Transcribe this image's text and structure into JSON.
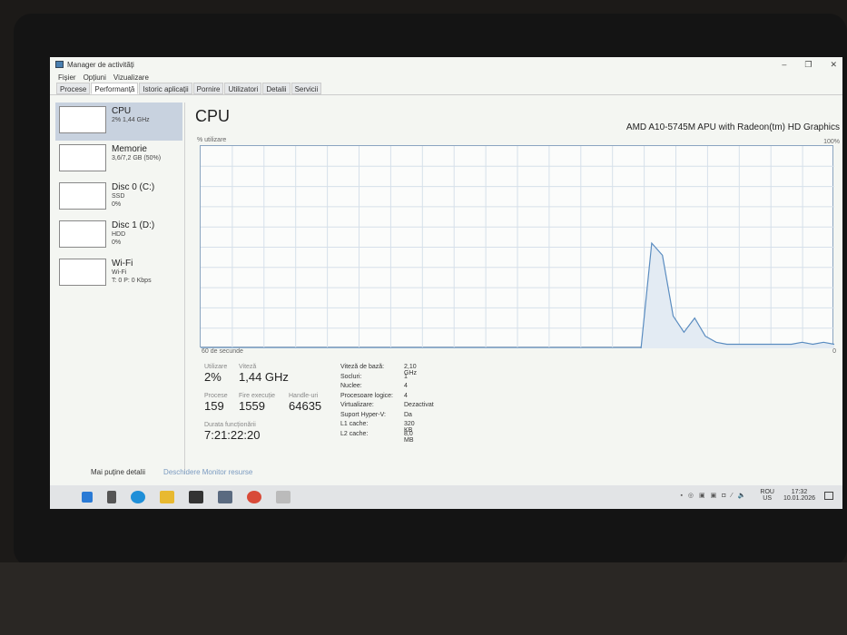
{
  "window": {
    "title": "Manager de activități",
    "controls": [
      "–",
      "❐",
      "✕"
    ]
  },
  "menu": [
    "Fișier",
    "Opțiuni",
    "Vizualizare"
  ],
  "tabs": [
    "Procese",
    "Performanță",
    "Istoric aplicații",
    "Pornire",
    "Utilizatori",
    "Detalii",
    "Servicii"
  ],
  "sidebar": [
    {
      "name": "CPU",
      "sub1": "2% 1,44 GHz",
      "sub2": ""
    },
    {
      "name": "Memorie",
      "sub1": "3,6/7,2 GB (50%)",
      "sub2": ""
    },
    {
      "name": "Disc 0 (C:)",
      "sub1": "SSD",
      "sub2": "0%"
    },
    {
      "name": "Disc 1 (D:)",
      "sub1": "HDD",
      "sub2": "0%"
    },
    {
      "name": "Wi-Fi",
      "sub1": "Wi-Fi",
      "sub2": "T: 0 P: 0 Kbps"
    }
  ],
  "main": {
    "title": "CPU",
    "model": "AMD A10-5745M APU with Radeon(tm) HD Graphics",
    "y_label": "% utilizare",
    "y_max": "100%",
    "y_min": "0",
    "x_label": "60 de secunde"
  },
  "chart_data": {
    "type": "area",
    "ylim": [
      0,
      100
    ],
    "xlabel": "60 de secunde",
    "ylabel": "% utilizare",
    "values": [
      0,
      0,
      0,
      0,
      0,
      0,
      0,
      0,
      0,
      0,
      0,
      0,
      0,
      0,
      0,
      0,
      0,
      0,
      0,
      0,
      0,
      0,
      0,
      0,
      0,
      0,
      0,
      0,
      0,
      0,
      0,
      0,
      0,
      0,
      0,
      0,
      0,
      0,
      0,
      0,
      0,
      0,
      52,
      46,
      16,
      8,
      15,
      6,
      3,
      2,
      2,
      2,
      2,
      2,
      2,
      2,
      3,
      2,
      3,
      2
    ]
  },
  "stats": {
    "util_label": "Utilizare",
    "util": "2%",
    "speed_label": "Viteză",
    "speed": "1,44 GHz",
    "proc_label": "Procese",
    "proc": "159",
    "threads_label": "Fire execuție",
    "threads": "1559",
    "handles_label": "Handle-uri",
    "handles": "64635",
    "uptime_label": "Durata funcționării",
    "uptime": "7:21:22:20"
  },
  "specs": [
    [
      "Viteză de bază:",
      "2,10 GHz"
    ],
    [
      "Socluri:",
      "1"
    ],
    [
      "Nuclee:",
      "4"
    ],
    [
      "Procesoare logice:",
      "4"
    ],
    [
      "Virtualizare:",
      "Dezactivat"
    ],
    [
      "Suport Hyper-V:",
      "Da"
    ],
    [
      "L1 cache:",
      "320 KB"
    ],
    [
      "L2 cache:",
      "8,0 MB"
    ]
  ],
  "footer": {
    "less": "Mai puține detalii",
    "monitor": "Deschidere Monitor resurse"
  },
  "tray": {
    "lang1": "ROU",
    "lang2": "US",
    "time": "17:32",
    "date": "10.01.2026"
  }
}
